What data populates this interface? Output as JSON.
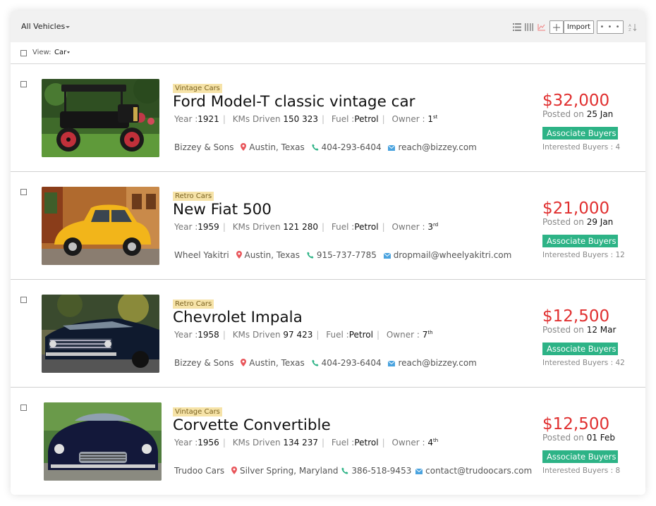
{
  "header": {
    "title": "All Vehicles",
    "import_label": "Import",
    "more_label": "• • •",
    "icons": [
      "list-view-icon",
      "grid-view-icon",
      "map-view-icon",
      "add-icon",
      "sort-icon"
    ]
  },
  "view": {
    "label": "View:",
    "value": "Car"
  },
  "colors": {
    "price": "#e02f2f",
    "assoc": "#2db386",
    "tag_bg": "#f6e3a8",
    "phone_icon": "#2db386",
    "mail_icon": "#4aa3df",
    "location_icon": "#e8555a"
  },
  "vehicles": [
    {
      "tag": "Vintage Cars",
      "title": "Ford Model-T classic vintage car",
      "year_label": "Year :",
      "year": "1921",
      "kms_label": "KMs Driven",
      "kms": "150 323",
      "fuel_label": "Fuel :",
      "fuel": "Petrol",
      "owner_label": "Owner :",
      "owner": "1",
      "owner_suffix": "st",
      "dealer": "Bizzey & Sons",
      "location": "Austin, Texas",
      "phone": "404-293-6404",
      "email": "reach@bizzey.com",
      "price": "$32,000",
      "posted_label": "Posted on",
      "posted_date": "25 Jan",
      "assoc_label": "Associate Buyers",
      "interested": "Interested Buyers : 4"
    },
    {
      "tag": "Retro Cars",
      "title": "New Fiat 500",
      "year_label": "Year :",
      "year": "1959",
      "kms_label": "KMs Driven",
      "kms": "121 280",
      "fuel_label": "Fuel :",
      "fuel": "Petrol",
      "owner_label": "Owner :",
      "owner": "3",
      "owner_suffix": "rd",
      "dealer": "Wheel Yakitri",
      "location": "Austin, Texas",
      "phone": "915-737-7785",
      "email": "dropmail@wheelyakitri.com",
      "price": "$21,000",
      "posted_label": "Posted on",
      "posted_date": "29 Jan",
      "assoc_label": "Associate Buyers",
      "interested": "Interested Buyers : 12"
    },
    {
      "tag": "Retro Cars",
      "title": "Chevrolet Impala",
      "year_label": "Year :",
      "year": "1958",
      "kms_label": "KMs Driven",
      "kms": "97 423",
      "fuel_label": "Fuel :",
      "fuel": "Petrol",
      "owner_label": "Owner :",
      "owner": "7",
      "owner_suffix": "th",
      "dealer": "Bizzey & Sons",
      "location": "Austin, Texas",
      "phone": "404-293-6404",
      "email": "reach@bizzey.com",
      "price": "$12,500",
      "posted_label": "Posted on",
      "posted_date": "12 Mar",
      "assoc_label": "Associate Buyers",
      "interested": "Interested Buyers : 42"
    },
    {
      "tag": "Vintage Cars",
      "title": "Corvette Convertible",
      "year_label": "Year :",
      "year": "1956",
      "kms_label": "KMs Driven",
      "kms": "134 237",
      "fuel_label": "Fuel :",
      "fuel": "Petrol",
      "owner_label": "Owner :",
      "owner": "4",
      "owner_suffix": "th",
      "dealer": "Trudoo Cars",
      "location": "Silver Spring, Maryland",
      "phone": "386-518-9453",
      "email": "contact@trudoocars.com",
      "price": "$12,500",
      "posted_label": "Posted on",
      "posted_date": "01 Feb",
      "assoc_label": "Associate Buyers",
      "interested": "Interested Buyers : 8"
    }
  ]
}
